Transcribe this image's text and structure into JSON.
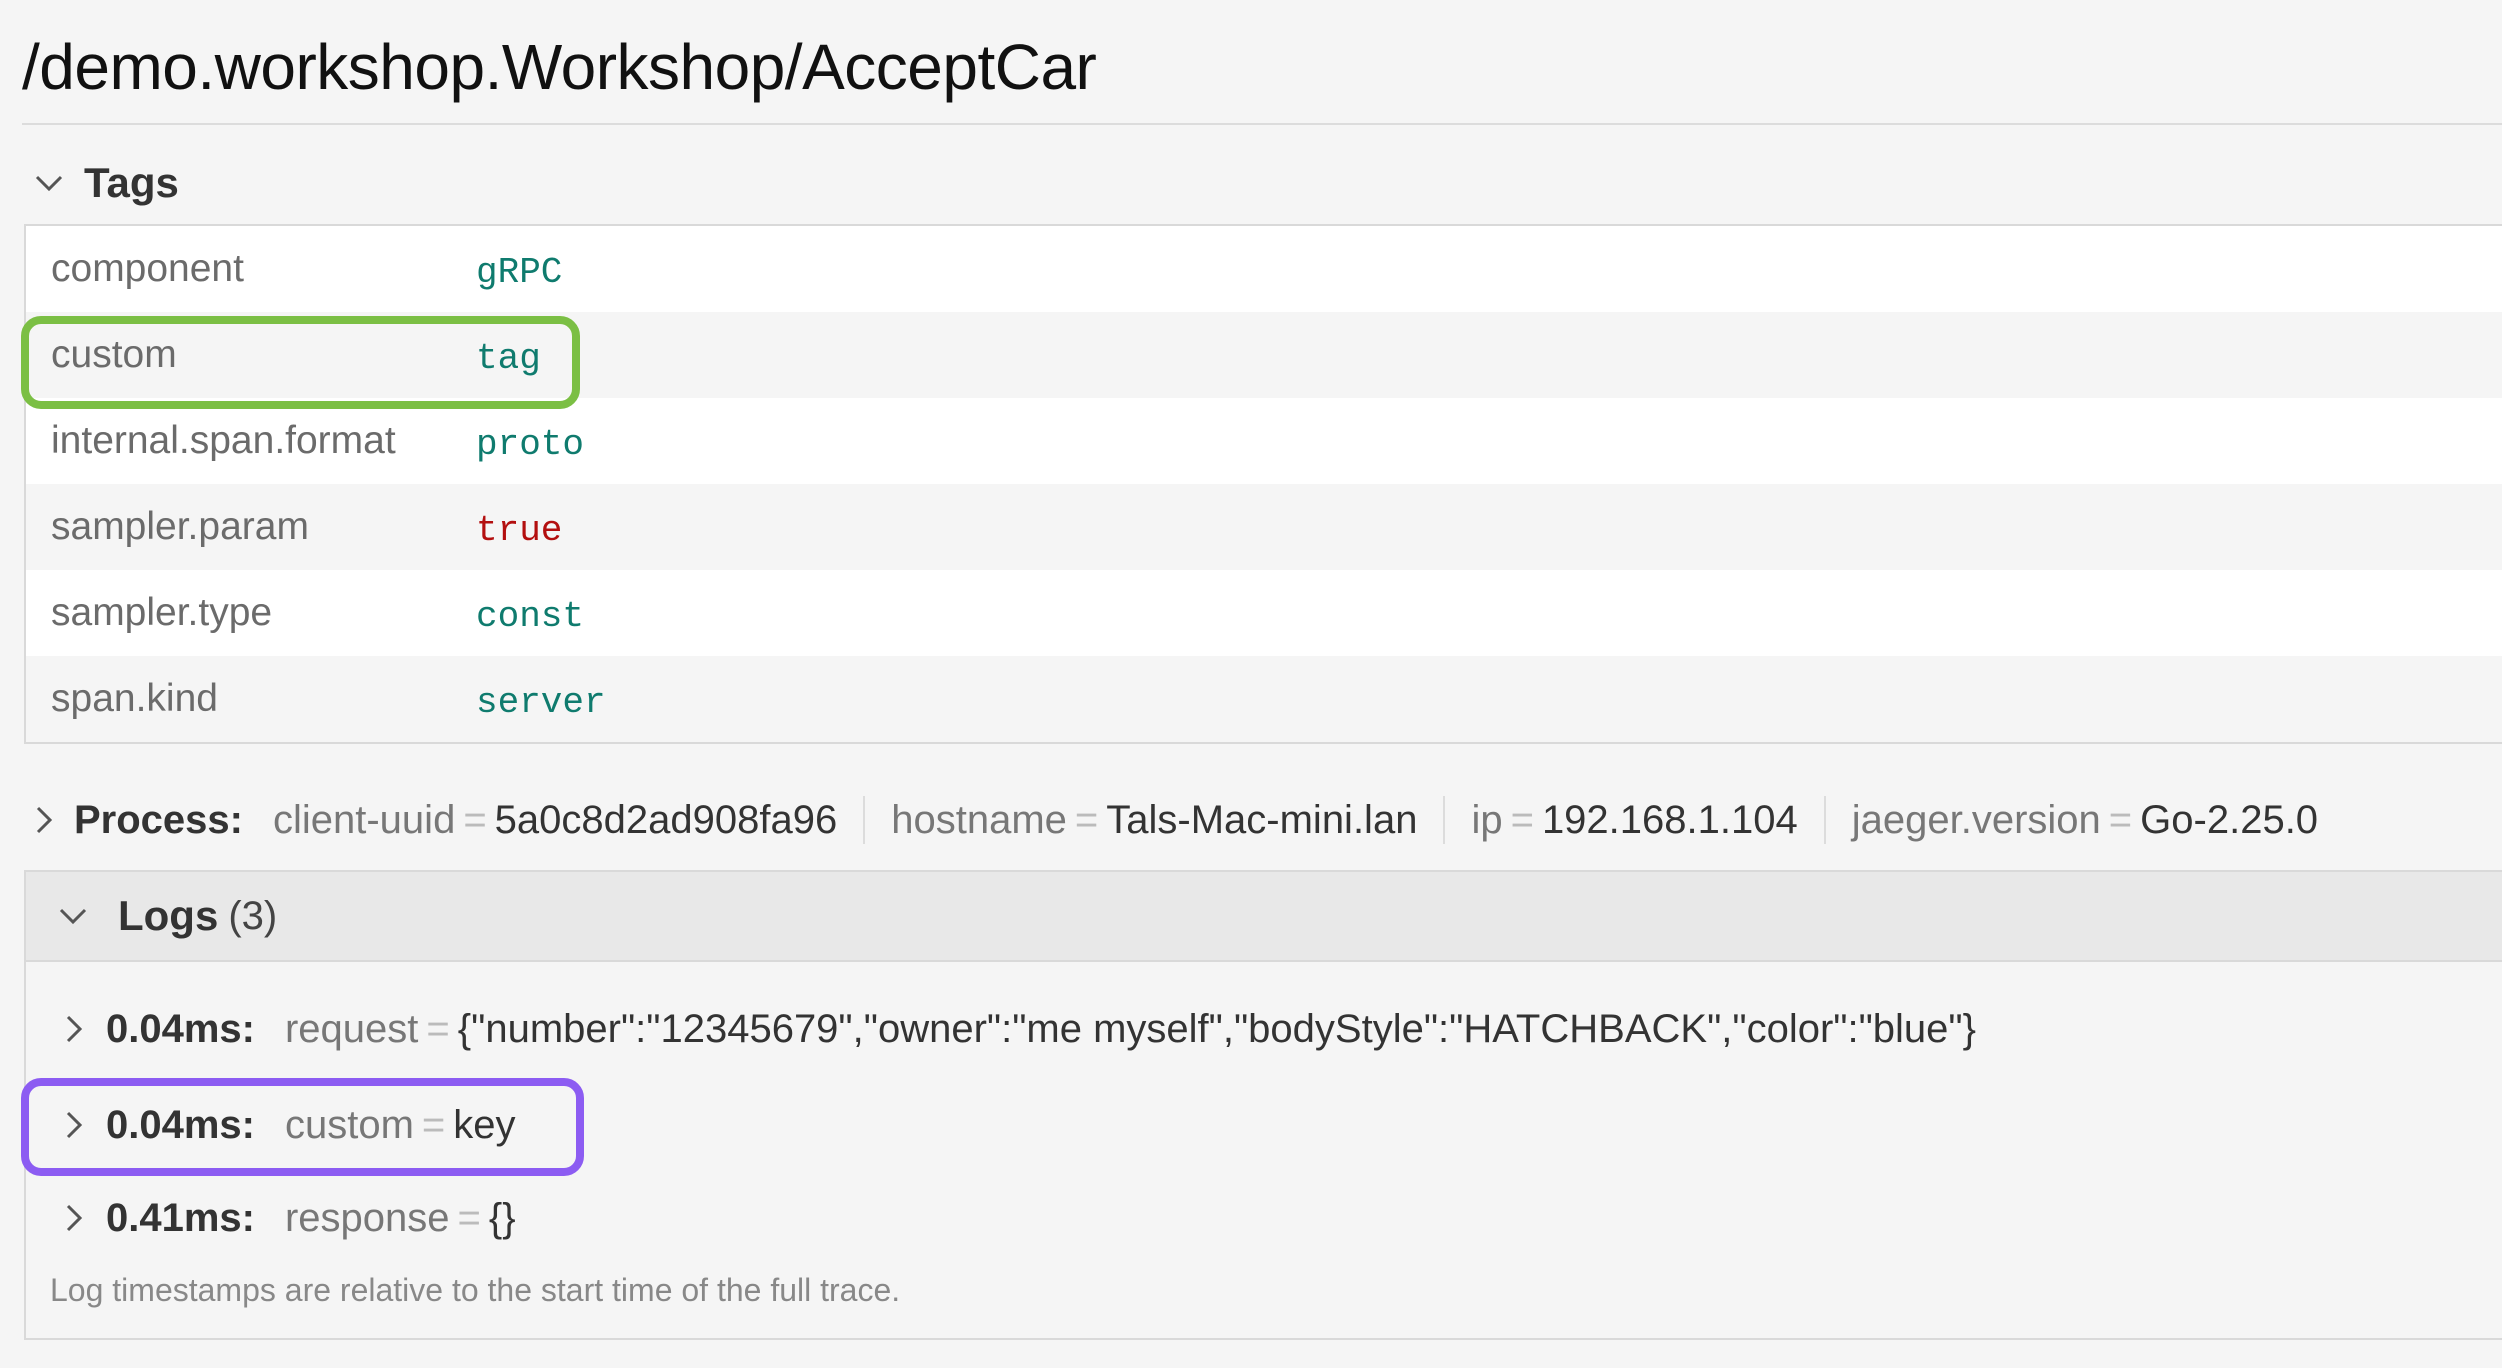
{
  "header": {
    "title": "/demo.workshop.Workshop/AcceptCar"
  },
  "tags": {
    "heading": "Tags",
    "rows": [
      {
        "key": "component",
        "value": "gRPC",
        "type": "string"
      },
      {
        "key": "custom",
        "value": "tag",
        "type": "string"
      },
      {
        "key": "internal.span.format",
        "value": "proto",
        "type": "string"
      },
      {
        "key": "sampler.param",
        "value": "true",
        "type": "bool"
      },
      {
        "key": "sampler.type",
        "value": "const",
        "type": "string"
      },
      {
        "key": "span.kind",
        "value": "server",
        "type": "string"
      }
    ]
  },
  "process": {
    "label": "Process:",
    "items": [
      {
        "key": "client-uuid",
        "value": "5a0c8d2ad908fa96"
      },
      {
        "key": "hostname",
        "value": "Tals-Mac-mini.lan"
      },
      {
        "key": "ip",
        "value": "192.168.1.104"
      },
      {
        "key": "jaeger.version",
        "value": "Go-2.25.0"
      }
    ]
  },
  "logs": {
    "heading": "Logs",
    "count": "(3)",
    "entries": [
      {
        "time": "0.04ms:",
        "key": "request",
        "value": "{\"number\":\"12345679\",\"owner\":\"me myself\",\"bodyStyle\":\"HATCHBACK\",\"color\":\"blue\"}"
      },
      {
        "time": "0.04ms:",
        "key": "custom",
        "value": "key"
      },
      {
        "time": "0.41ms:",
        "key": "response",
        "value": "{}"
      }
    ],
    "footnote": "Log timestamps are relative to the start time of the full trace."
  },
  "colors": {
    "string_value": "#0f7b6e",
    "bool_value": "#b30f0f",
    "highlight_tag": "#7bbf44",
    "highlight_log": "#8c5cf2"
  },
  "icons": {
    "expanded": "chevron-down-icon",
    "collapsed": "chevron-right-icon"
  }
}
